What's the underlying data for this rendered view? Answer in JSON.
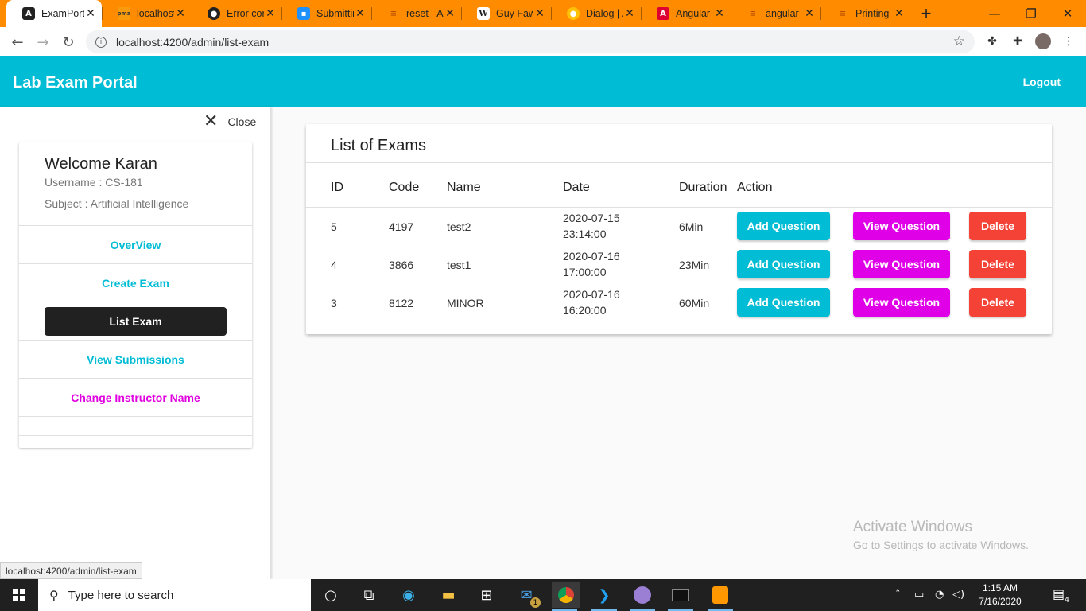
{
  "browser": {
    "tabs": [
      {
        "label": "ExamPort",
        "favicon": "angular-icon",
        "color": "#222222",
        "active": true
      },
      {
        "label": "localhost",
        "favicon": "phpmyadmin-icon",
        "color": "#f89c0e"
      },
      {
        "label": "Error cor",
        "favicon": "github-icon",
        "color": "#222222"
      },
      {
        "label": "Submittin",
        "favicon": "chat-icon",
        "color": "#1e90ff"
      },
      {
        "label": "reset - A",
        "favicon": "stackoverflow-icon",
        "color": "#f48024"
      },
      {
        "label": "Guy Fawk",
        "favicon": "wikipedia-icon",
        "color": "#ffffff"
      },
      {
        "label": "Dialog | A",
        "favicon": "material-icon",
        "color": "#ffc107"
      },
      {
        "label": "Angular",
        "favicon": "angular-icon",
        "color": "#dd0031"
      },
      {
        "label": "angular",
        "favicon": "stackoverflow-icon",
        "color": "#f48024"
      },
      {
        "label": "Printing",
        "favicon": "stackoverflow-icon",
        "color": "#f48024"
      }
    ],
    "url": "localhost:4200/admin/list-exam",
    "status_url": "localhost:4200/admin/list-exam"
  },
  "app": {
    "title": "Lab Exam Portal",
    "logout": "Logout"
  },
  "sidebar": {
    "close_label": "Close",
    "welcome": "Welcome Karan",
    "username": "Username : CS-181",
    "subject": "Subject : Artificial Intelligence",
    "items": [
      {
        "label": "OverView"
      },
      {
        "label": "Create Exam"
      },
      {
        "label": "List Exam"
      },
      {
        "label": "View Submissions"
      },
      {
        "label": "Change Instructor Name"
      }
    ]
  },
  "exams": {
    "title": "List of Exams",
    "columns": [
      "ID",
      "Code",
      "Name",
      "Date",
      "Duration",
      "Action"
    ],
    "rows": [
      {
        "id": "5",
        "code": "4197",
        "name": "test2",
        "date1": "2020-07-15",
        "date2": "23:14:00",
        "duration": "6Min"
      },
      {
        "id": "4",
        "code": "3866",
        "name": "test1",
        "date1": "2020-07-16",
        "date2": "17:00:00",
        "duration": "23Min"
      },
      {
        "id": "3",
        "code": "8122",
        "name": "MINOR",
        "date1": "2020-07-16",
        "date2": "16:20:00",
        "duration": "60Min"
      }
    ],
    "actions": {
      "add": "Add Question",
      "view": "View Question",
      "delete": "Delete"
    }
  },
  "watermark": {
    "line1": "Activate Windows",
    "line2": "Go to Settings to activate Windows."
  },
  "taskbar": {
    "search_placeholder": "Type here to search",
    "time": "1:15 AM",
    "date": "7/16/2020",
    "mail_badge": "1",
    "notification_count": "4"
  },
  "colors": {
    "primary": "#00bcd4",
    "accent": "#e000e8",
    "warn": "#f44336",
    "tabstrip": "#ff8c00"
  }
}
